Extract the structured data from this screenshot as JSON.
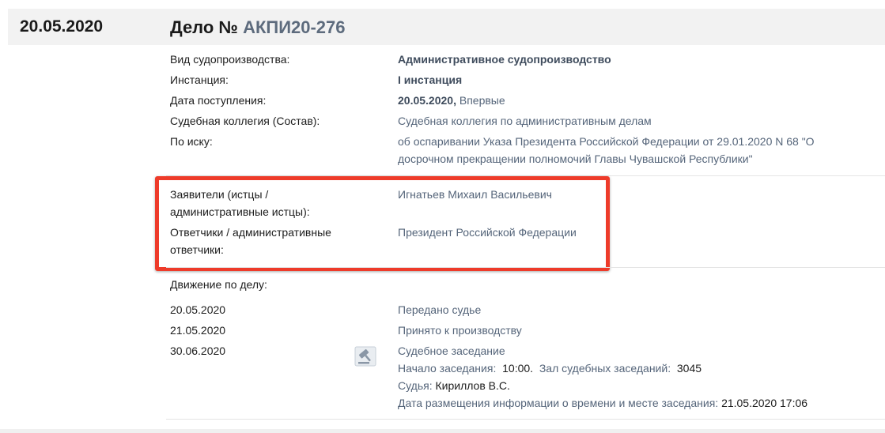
{
  "header": {
    "date": "20.05.2020",
    "case_prefix": "Дело № ",
    "case_number": "АКПИ20-276"
  },
  "details": {
    "proceeding_label": "Вид судопроизводства:",
    "proceeding_value": "Административное судопроизводство",
    "instance_label": "Инстанция:",
    "instance_value": "I инстанция",
    "received_label": "Дата поступления:",
    "received_date": "20.05.2020,",
    "received_note": "Впервые",
    "board_label": "Судебная коллегия (Состав):",
    "board_value": "Судебная коллегия по административным делам",
    "claim_label": "По иску:",
    "claim_line1": "об оспаривании Указа Президента Российской Федерации от 29.01.2020 N 68 \"О",
    "claim_line2": "досрочном прекращении полномочий Главы Чувашской Республики\""
  },
  "parties": {
    "applicants_label_1": "Заявители (истцы /",
    "applicants_label_2": "административные истцы):",
    "applicants_value": "Игнатьев Михаил Васильевич",
    "respondents_label_1": "Ответчики / административные",
    "respondents_label_2": "ответчики:",
    "respondents_value": "Президент Российской Федерации"
  },
  "movement": {
    "title": "Движение по делу:",
    "events": [
      {
        "date": "20.05.2020",
        "text": "Передано судье"
      },
      {
        "date": "21.05.2020",
        "text": "Принято к производству"
      },
      {
        "date": "30.06.2020",
        "text": "Судебное заседание"
      }
    ],
    "session": {
      "start_label": "Начало заседания:",
      "start_time": "10:00.",
      "hall_label": "Зал судебных заседаний:",
      "hall_number": "3045",
      "judge_label": "Судья:",
      "judge_name": "Кириллов В.С.",
      "posted_label": "Дата размещения информации о времени и месте заседания:",
      "posted_value": "21.05.2020 17:06"
    }
  },
  "icons": {
    "session_icon": "gavel-icon"
  },
  "colors": {
    "highlight": "#ee3b2a",
    "link_gray": "#5d6b7d"
  }
}
